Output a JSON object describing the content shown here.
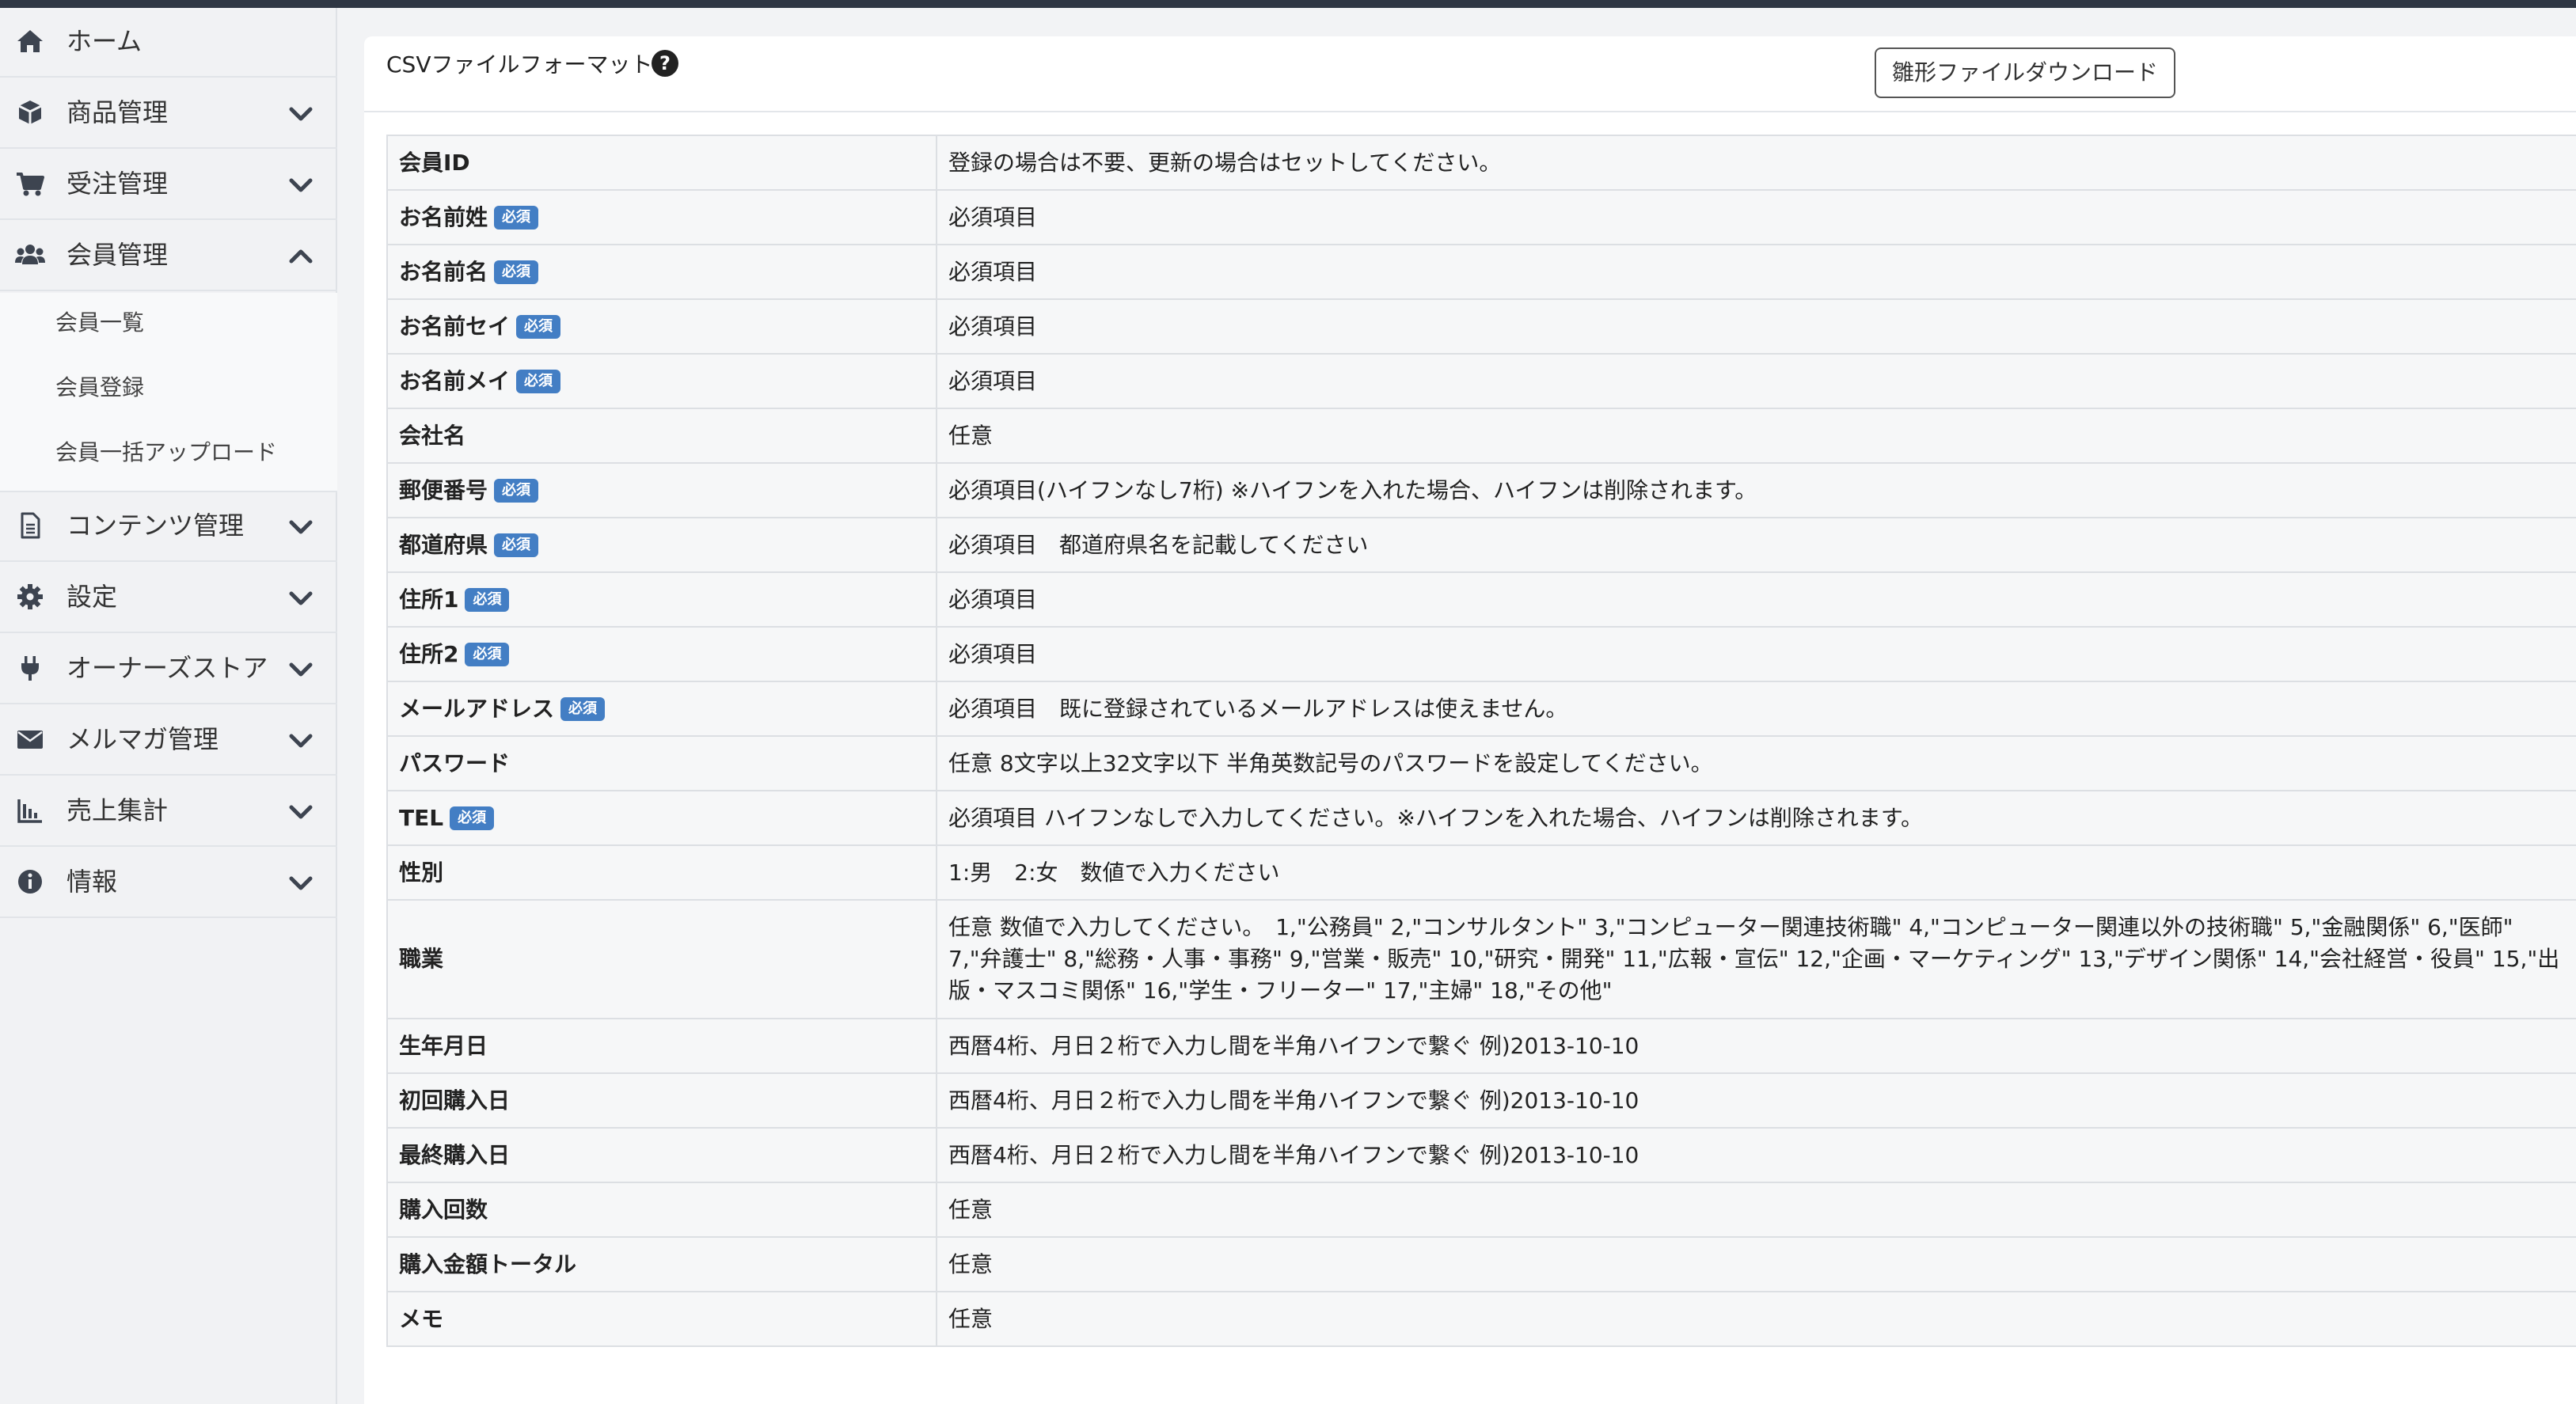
{
  "sidebar": {
    "items": [
      {
        "label": "ホーム",
        "icon": "home-icon",
        "expandable": false
      },
      {
        "label": "商品管理",
        "icon": "cube-icon",
        "expandable": true,
        "expanded": false
      },
      {
        "label": "受注管理",
        "icon": "cart-icon",
        "expandable": true,
        "expanded": false
      },
      {
        "label": "会員管理",
        "icon": "users-icon",
        "expandable": true,
        "expanded": true
      },
      {
        "label": "コンテンツ管理",
        "icon": "file-icon",
        "expandable": true,
        "expanded": false
      },
      {
        "label": "設定",
        "icon": "gear-icon",
        "expandable": true,
        "expanded": false
      },
      {
        "label": "オーナーズストア",
        "icon": "plug-icon",
        "expandable": true,
        "expanded": false
      },
      {
        "label": "メルマガ管理",
        "icon": "envelope-icon",
        "expandable": true,
        "expanded": false
      },
      {
        "label": "売上集計",
        "icon": "chart-icon",
        "expandable": true,
        "expanded": false
      },
      {
        "label": "情報",
        "icon": "info-icon",
        "expandable": true,
        "expanded": false
      }
    ],
    "subitems": [
      {
        "label": "会員一覧"
      },
      {
        "label": "会員登録"
      },
      {
        "label": "会員一括アップロード"
      }
    ]
  },
  "card": {
    "title": "CSVファイルフォーマット",
    "download_label": "雛形ファイルダウンロード"
  },
  "required_badge": "必須",
  "colors": {
    "badge": "#437ec4",
    "topbar": "#2f3744",
    "sidebar_bg": "#f1f2f4",
    "row_bg": "#f6f7f8"
  },
  "rows": [
    {
      "label": "会員ID",
      "required": false,
      "desc": "登録の場合は不要、更新の場合はセットしてください。"
    },
    {
      "label": "お名前姓",
      "required": true,
      "desc": "必須項目"
    },
    {
      "label": "お名前名",
      "required": true,
      "desc": "必須項目"
    },
    {
      "label": "お名前セイ",
      "required": true,
      "desc": "必須項目"
    },
    {
      "label": "お名前メイ",
      "required": true,
      "desc": "必須項目"
    },
    {
      "label": "会社名",
      "required": false,
      "desc": "任意"
    },
    {
      "label": "郵便番号",
      "required": true,
      "desc": "必須項目(ハイフンなし7桁) ※ハイフンを入れた場合、ハイフンは削除されます。"
    },
    {
      "label": "都道府県",
      "required": true,
      "desc": "必須項目　都道府県名を記載してください"
    },
    {
      "label": "住所1",
      "required": true,
      "desc": "必須項目"
    },
    {
      "label": "住所2",
      "required": true,
      "desc": "必須項目"
    },
    {
      "label": "メールアドレス",
      "required": true,
      "desc": "必須項目　既に登録されているメールアドレスは使えません。"
    },
    {
      "label": "パスワード",
      "required": false,
      "desc": "任意 8文字以上32文字以下 半角英数記号のパスワードを設定してください。"
    },
    {
      "label": "TEL",
      "required": true,
      "desc": "必須項目 ハイフンなしで入力してください。※ハイフンを入れた場合、ハイフンは削除されます。"
    },
    {
      "label": "性別",
      "required": false,
      "desc": "1:男　2:女　数値で入力ください"
    },
    {
      "label": "職業",
      "required": false,
      "desc": "任意 数値で入力してください。　1,\"公務員\" 2,\"コンサルタント\" 3,\"コンピューター関連技術職\" 4,\"コンピューター関連以外の技術職\" 5,\"金融関係\" 6,\"医師\" 7,\"弁護士\" 8,\"総務・人事・事務\" 9,\"営業・販売\" 10,\"研究・開発\" 11,\"広報・宣伝\" 12,\"企画・マーケティング\" 13,\"デザイン関係\" 14,\"会社経営・役員\" 15,\"出版・マスコミ関係\" 16,\"学生・フリーター\" 17,\"主婦\" 18,\"その他\""
    },
    {
      "label": "生年月日",
      "required": false,
      "desc": "西暦4桁、月日２桁で入力し間を半角ハイフンで繋ぐ 例)2013-10-10"
    },
    {
      "label": "初回購入日",
      "required": false,
      "desc": "西暦4桁、月日２桁で入力し間を半角ハイフンで繋ぐ 例)2013-10-10"
    },
    {
      "label": "最終購入日",
      "required": false,
      "desc": "西暦4桁、月日２桁で入力し間を半角ハイフンで繋ぐ 例)2013-10-10"
    },
    {
      "label": "購入回数",
      "required": false,
      "desc": "任意"
    },
    {
      "label": "購入金額トータル",
      "required": false,
      "desc": "任意"
    },
    {
      "label": "メモ",
      "required": false,
      "desc": "任意"
    }
  ]
}
